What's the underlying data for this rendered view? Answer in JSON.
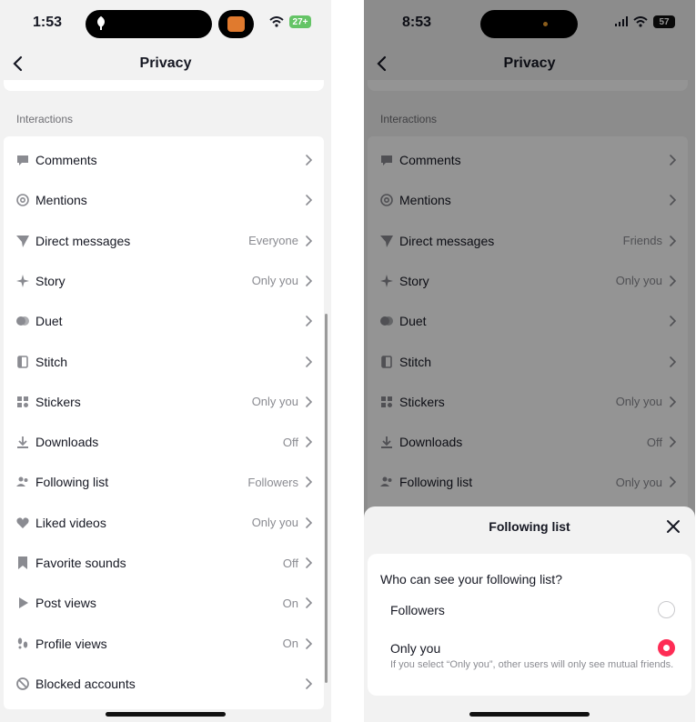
{
  "left_screen": {
    "status": {
      "time": "1:53",
      "battery": "27+",
      "battery_color": "#65c466"
    },
    "header": {
      "title": "Privacy"
    },
    "section_label": "Interactions",
    "items": [
      {
        "label": "Comments",
        "value": "",
        "icon": "comment-icon"
      },
      {
        "label": "Mentions",
        "value": "",
        "icon": "at-icon"
      },
      {
        "label": "Direct messages",
        "value": "Everyone",
        "icon": "send-icon"
      },
      {
        "label": "Story",
        "value": "Only you",
        "icon": "sparkle-icon"
      },
      {
        "label": "Duet",
        "value": "",
        "icon": "duet-icon"
      },
      {
        "label": "Stitch",
        "value": "",
        "icon": "stitch-icon"
      },
      {
        "label": "Stickers",
        "value": "Only you",
        "icon": "sticker-icon"
      },
      {
        "label": "Downloads",
        "value": "Off",
        "icon": "download-icon"
      },
      {
        "label": "Following list",
        "value": "Followers",
        "icon": "users-icon"
      },
      {
        "label": "Liked videos",
        "value": "Only you",
        "icon": "heart-icon"
      },
      {
        "label": "Favorite sounds",
        "value": "Off",
        "icon": "bookmark-icon"
      },
      {
        "label": "Post views",
        "value": "On",
        "icon": "play-icon"
      },
      {
        "label": "Profile views",
        "value": "On",
        "icon": "footprints-icon"
      },
      {
        "label": "Blocked accounts",
        "value": "",
        "icon": "blocked-icon"
      }
    ]
  },
  "right_screen": {
    "status": {
      "time": "8:53",
      "battery": "57",
      "battery_color": "#111111"
    },
    "header": {
      "title": "Privacy"
    },
    "section_label": "Interactions",
    "items": [
      {
        "label": "Comments",
        "value": "",
        "icon": "comment-icon"
      },
      {
        "label": "Mentions",
        "value": "",
        "icon": "at-icon"
      },
      {
        "label": "Direct messages",
        "value": "Friends",
        "icon": "send-icon"
      },
      {
        "label": "Story",
        "value": "Only you",
        "icon": "sparkle-icon"
      },
      {
        "label": "Duet",
        "value": "",
        "icon": "duet-icon"
      },
      {
        "label": "Stitch",
        "value": "",
        "icon": "stitch-icon"
      },
      {
        "label": "Stickers",
        "value": "Only you",
        "icon": "sticker-icon"
      },
      {
        "label": "Downloads",
        "value": "Off",
        "icon": "download-icon"
      },
      {
        "label": "Following list",
        "value": "Only you",
        "icon": "users-icon"
      }
    ],
    "sheet": {
      "title": "Following list",
      "question": "Who can see your following list?",
      "options": [
        {
          "label": "Followers",
          "selected": false
        },
        {
          "label": "Only you",
          "selected": true
        }
      ],
      "note": "If you select “Only you”, other users will only see mutual friends.",
      "accent_color": "#fe2c55"
    }
  }
}
